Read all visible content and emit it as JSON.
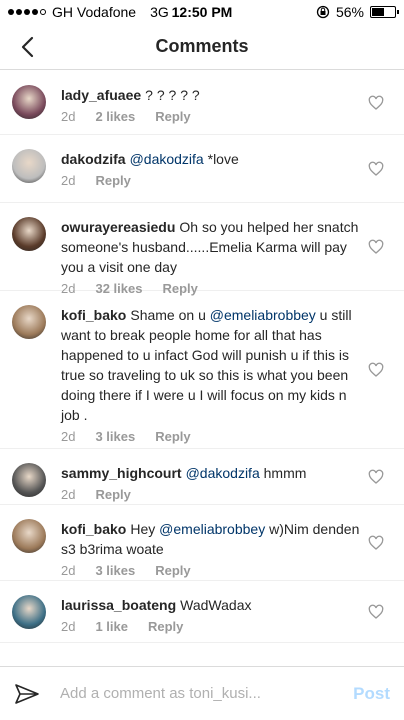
{
  "status": {
    "carrier": "GH Vodafone",
    "network": "3G",
    "time": "12:50 PM",
    "battery": "56%",
    "battery_level": 0.56,
    "signal_bars_filled": 4
  },
  "header": {
    "title": "Comments",
    "back_icon": "chevron-left-icon"
  },
  "comments": [
    {
      "username": "lady_afuaee",
      "segments": [
        {
          "type": "text",
          "value": "? ? ? ? ?"
        }
      ],
      "time": "2d",
      "likes": "2 likes",
      "reply": "Reply",
      "avatar_color": "#7a4a5c"
    },
    {
      "username": "dakodzifa",
      "segments": [
        {
          "type": "mention",
          "value": "@dakodzifa"
        },
        {
          "type": "text",
          "value": " *love"
        }
      ],
      "time": "2d",
      "likes": "",
      "reply": "Reply",
      "avatar_color": "#bdbdbd"
    },
    {
      "username": "owurayereasiedu",
      "segments": [
        {
          "type": "text",
          "value": "Oh so you helped her snatch someone's  husband......Emelia Karma will pay you a visit one day"
        }
      ],
      "time": "2d",
      "likes": "32 likes",
      "reply": "Reply",
      "avatar_color": "#5a3b2a"
    },
    {
      "username": "kofi_bako",
      "segments": [
        {
          "type": "text",
          "value": "Shame on u "
        },
        {
          "type": "mention",
          "value": "@emeliabrobbey"
        },
        {
          "type": "text",
          "value": " u still want to break people home for all that has happened to u infact God will punish u if this is true so traveling to uk so this is what you been doing there if I were u I will focus on my kids n job ."
        }
      ],
      "time": "2d",
      "likes": "3 likes",
      "reply": "Reply",
      "avatar_color": "#9c7a5a"
    },
    {
      "username": "sammy_highcourt",
      "segments": [
        {
          "type": "mention",
          "value": "@dakodzifa"
        },
        {
          "type": "text",
          "value": " hmmm"
        }
      ],
      "time": "2d",
      "likes": "",
      "reply": "Reply",
      "avatar_color": "#555555"
    },
    {
      "username": "kofi_bako",
      "segments": [
        {
          "type": "text",
          "value": "Hey "
        },
        {
          "type": "mention",
          "value": "@emeliabrobbey"
        },
        {
          "type": "text",
          "value": "  w)Nim denden s3 b3rima woate"
        }
      ],
      "time": "2d",
      "likes": "3 likes",
      "reply": "Reply",
      "avatar_color": "#9c7a5a"
    },
    {
      "username": "laurissa_boateng",
      "segments": [
        {
          "type": "text",
          "value": "WadWadax"
        }
      ],
      "time": "2d",
      "likes": "1 like",
      "reply": "Reply",
      "avatar_color": "#3d6f86"
    }
  ],
  "compose": {
    "placeholder": "Add a comment as toni_kusi...",
    "post_label": "Post",
    "send_icon": "paper-plane-icon"
  },
  "colors": {
    "mention": "#003569",
    "post_disabled": "#b3dbff",
    "meta": "#999999"
  }
}
